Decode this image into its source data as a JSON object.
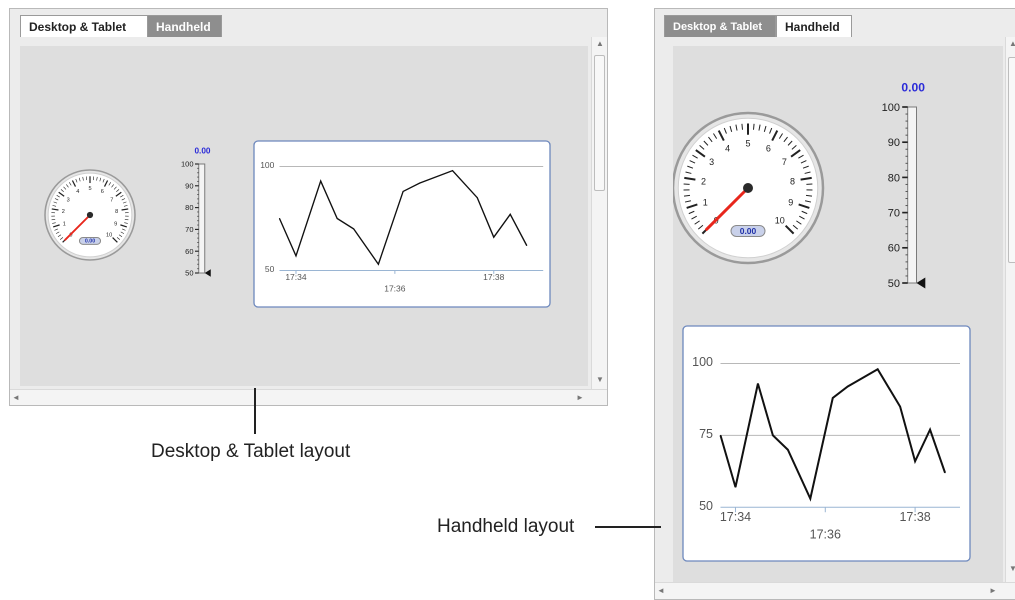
{
  "desktop": {
    "tabs": [
      {
        "label": "Desktop & Tablet",
        "active": true
      },
      {
        "label": "Handheld",
        "active": false
      }
    ],
    "gauge": {
      "value": 0,
      "value_text": "0.00",
      "min": 0,
      "max": 10,
      "ticks": [
        "0",
        "1",
        "2",
        "3",
        "4",
        "5",
        "6",
        "7",
        "8",
        "9",
        "10"
      ]
    },
    "thermo": {
      "value_text": "0.00",
      "min": 50,
      "max": 100,
      "ticks": [
        "100",
        "90",
        "80",
        "70",
        "60",
        "50"
      ]
    },
    "chart": {
      "y_ticks": [
        "100",
        "50"
      ],
      "x_ticks": [
        "17:34",
        "17:36",
        "17:38"
      ]
    }
  },
  "handheld": {
    "tabs": [
      {
        "label": "Desktop & Tablet",
        "active": false
      },
      {
        "label": "Handheld",
        "active": true
      }
    ],
    "gauge": {
      "value": 0,
      "value_text": "0.00",
      "min": 0,
      "max": 10,
      "ticks": [
        "0",
        "1",
        "2",
        "3",
        "4",
        "5",
        "6",
        "7",
        "8",
        "9",
        "10"
      ]
    },
    "thermo": {
      "value_text": "0.00",
      "min": 50,
      "max": 100,
      "ticks": [
        "100",
        "90",
        "80",
        "70",
        "60",
        "50"
      ]
    },
    "chart": {
      "y_ticks": [
        "100",
        "75",
        "50"
      ],
      "x_ticks": [
        "17:34",
        "17:36",
        "17:38"
      ]
    }
  },
  "captions": {
    "desktop": "Desktop & Tablet layout",
    "handheld": "Handheld layout"
  },
  "colors": {
    "needle": "#e8261c",
    "value": "#2b2bd8",
    "chart_line": "#111111"
  },
  "chart_data": {
    "type": "line",
    "x": [
      "17:33:40",
      "17:34:00",
      "17:34:30",
      "17:34:50",
      "17:35:10",
      "17:35:40",
      "17:36:10",
      "17:36:30",
      "17:37:10",
      "17:37:40",
      "17:38:00",
      "17:38:20",
      "17:38:40",
      "17:39:00"
    ],
    "x_ticks": [
      "17:34",
      "17:36",
      "17:38"
    ],
    "series": [
      {
        "values": [
          75,
          57,
          93,
          75,
          70,
          53,
          88,
          92,
          98,
          85,
          66,
          77,
          62
        ]
      }
    ],
    "ylim": [
      50,
      100
    ],
    "y_ticks": [
      50,
      75,
      100
    ],
    "grid": true
  }
}
